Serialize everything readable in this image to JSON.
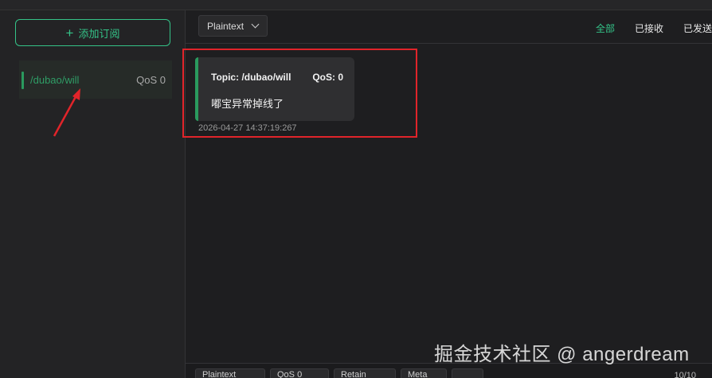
{
  "sidebar": {
    "add_subscription_label": "添加订阅",
    "subscriptions": [
      {
        "topic": "/dubao/will",
        "qos": "QoS 0",
        "color": "#2a9a5e"
      }
    ]
  },
  "toolbar": {
    "payload_format": "Plaintext",
    "filters": {
      "all": "全部",
      "received": "已接收",
      "sent": "已发送"
    },
    "active_filter": "all"
  },
  "messages": [
    {
      "topic_label": "Topic: /dubao/will",
      "qos_label": "QoS: 0",
      "payload": "嘟宝异常掉线了",
      "timestamp": "2026-04-27 14:37:19:267"
    }
  ],
  "bottombar": {
    "format": "Plaintext",
    "qos": "QoS 0",
    "retain": "Retain",
    "meta": "Meta",
    "count": "10/10"
  },
  "watermark": "掘金技术社区 @ angerdream",
  "colors": {
    "accent": "#34c388",
    "highlight": "#e1242a",
    "background": "#1e1e20"
  }
}
